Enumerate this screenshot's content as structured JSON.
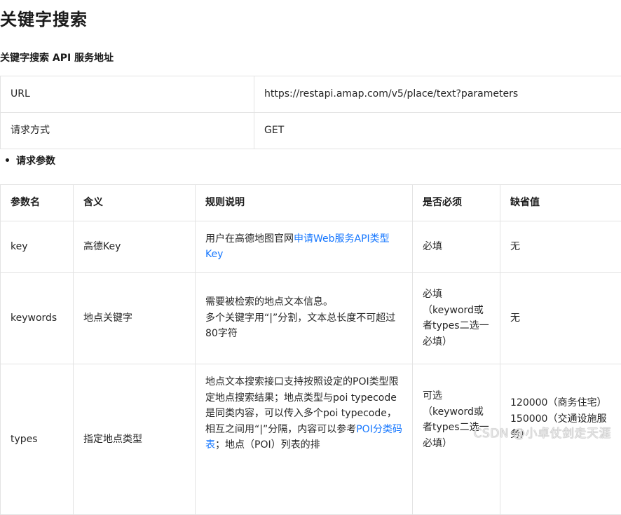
{
  "title": "关键字搜索",
  "section_title": "关键字搜索 API 服务地址",
  "service_table": [
    {
      "label": "URL",
      "value": "https://restapi.amap.com/v5/place/text?parameters"
    },
    {
      "label": "请求方式",
      "value": "GET"
    }
  ],
  "params_heading": "请求参数",
  "params_table": {
    "headers": [
      "参数名",
      "含义",
      "规则说明",
      "是否必须",
      "缺省值"
    ],
    "rows": [
      {
        "name": "key",
        "meaning": "高德Key",
        "rule_prefix": "用户在高德地图官网",
        "rule_link": "申请Web服务API类型Key",
        "required": "必填",
        "default": "无"
      },
      {
        "name": "keywords",
        "meaning": "地点关键字",
        "rule_line1": "需要被检索的地点文本信息。",
        "rule_line2": "多个关键字用“|”分割，文本总长度不可超过80字符",
        "required": "必填（keyword或者types二选一必填）",
        "default": "无"
      },
      {
        "name": "types",
        "meaning": "指定地点类型",
        "rule_text": "地点文本搜索接口支持按照设定的POI类型限定地点搜索结果；地点类型与poi typecode是同类内容，可以传入多个poi typecode，相互之间用“|”分隔，内容可以参考",
        "rule_link": "POI分类码表",
        "rule_suffix": "；地点（POI）列表的排",
        "required": "可选（keyword或者types二选一必填）",
        "default_line1": "120000（商务住宅）",
        "default_line2": "150000（交通设施服务）"
      }
    ]
  },
  "watermark": "CSDN @小卓仗剑走天涯"
}
